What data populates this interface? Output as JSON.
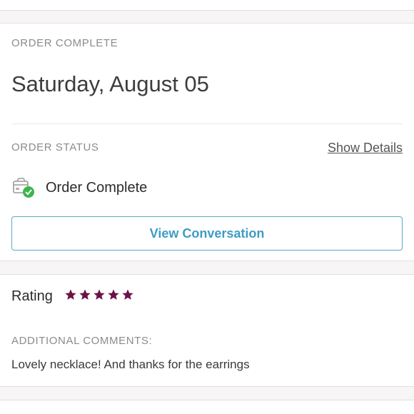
{
  "order": {
    "section_label": "ORDER COMPLETE",
    "date": "Saturday, August 05",
    "status_label": "ORDER STATUS",
    "show_details": "Show Details",
    "status_text": "Order Complete",
    "view_conversation": "View Conversation"
  },
  "rating": {
    "label": "Rating",
    "stars": 5,
    "max_stars": 5,
    "star_color": "#6b1347",
    "comments_label": "ADDITIONAL COMMENTS:",
    "comment": "Lovely necklace! And thanks for the earrings"
  },
  "colors": {
    "accent": "#3f9cc4",
    "success": "#3cb54a"
  },
  "icons": {
    "status": "package-check-icon"
  }
}
